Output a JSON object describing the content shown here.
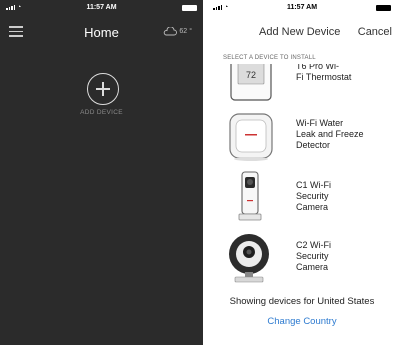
{
  "left_screen": {
    "status_time": "11:57 AM",
    "title": "Home",
    "weather_temp": "62",
    "weather_icon": "cloud-icon",
    "menu_icon": "hamburger-menu-icon",
    "add_device_label": "ADD DEVICE",
    "background": "#2b2b2b"
  },
  "right_screen": {
    "status_time": "11:57 AM",
    "title": "Add New Device",
    "cancel_label": "Cancel",
    "section_label": "SELECT A DEVICE TO INSTALL",
    "devices": [
      {
        "name": "T6 Pro Wi-Fi Thermostat",
        "name_lines": [
          "T6 Pro Wi-",
          "Fi Thermostat"
        ],
        "display": "72",
        "icon": "thermostat-icon"
      },
      {
        "name": "Wi-Fi Water Leak and Freeze Detector",
        "name_lines": [
          "Wi-Fi Water",
          "Leak and Freeze",
          "Detector"
        ],
        "icon": "water-leak-detector-icon"
      },
      {
        "name": "C1 Wi-Fi Security Camera",
        "name_lines": [
          "C1 Wi-Fi",
          "Security",
          "Camera"
        ],
        "icon": "c1-camera-icon"
      },
      {
        "name": "C2 Wi-Fi Security Camera",
        "name_lines": [
          "C2 Wi-Fi",
          "Security",
          "Camera"
        ],
        "icon": "c2-camera-icon"
      }
    ],
    "footer_text": "Showing devices for United States",
    "change_country_label": "Change Country",
    "link_color": "#2e7bd0"
  }
}
